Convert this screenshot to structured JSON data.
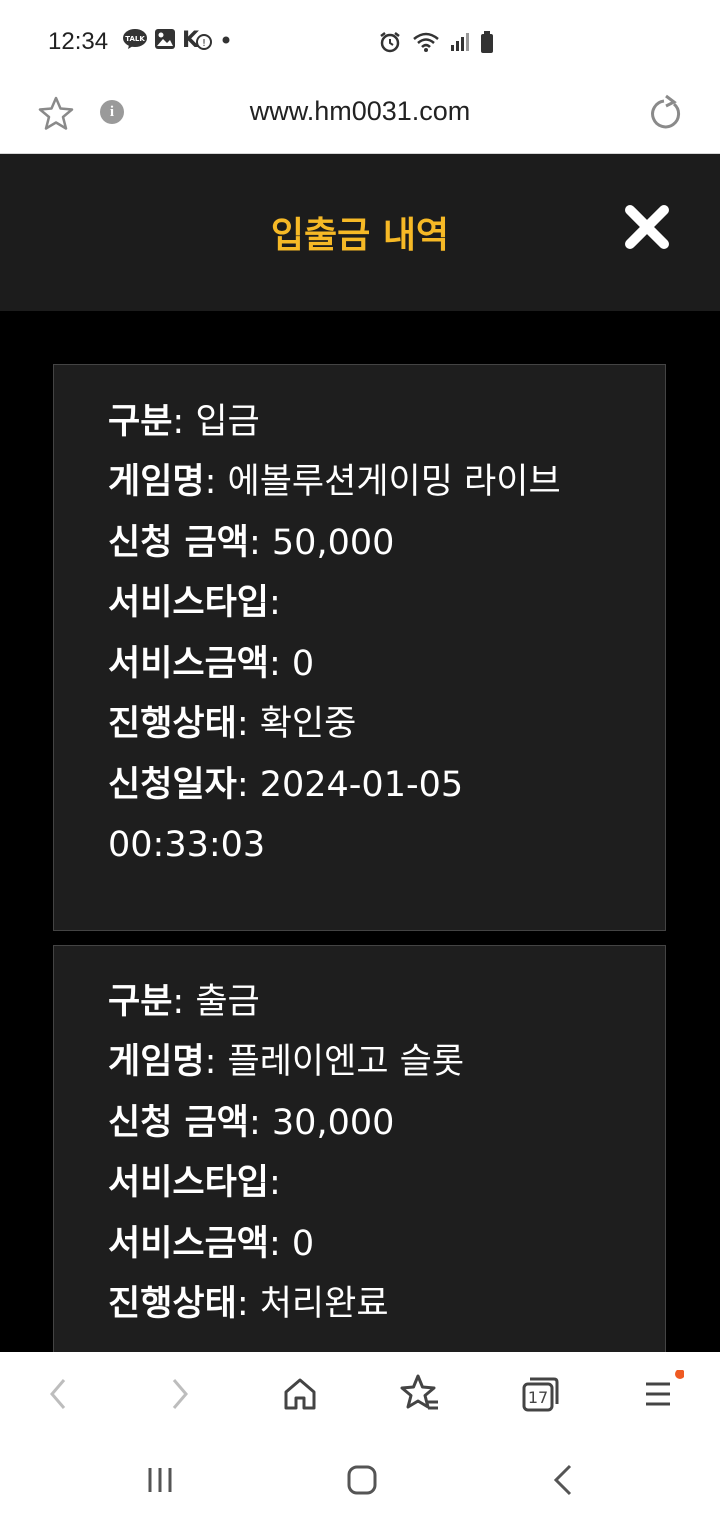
{
  "status_bar": {
    "time": "12:34",
    "icons": [
      "kakaotalk-icon",
      "gallery-icon",
      "notification-icon",
      "dot-icon",
      "alarm-icon",
      "wifi-icon",
      "signal-icon",
      "battery-icon"
    ]
  },
  "browser": {
    "url": "www.hm0031.com",
    "tab_count": "17"
  },
  "page": {
    "title": "입출금 내역",
    "accent_color": "#f6b926"
  },
  "transactions": [
    {
      "type_label": "구분",
      "type_value": ": 입금",
      "game_label": "게임명",
      "game_value": ": 에볼루션게이밍 라이브",
      "amount_label": "신청 금액",
      "amount_value": ": 50,000",
      "service_type_label": "서비스타입",
      "service_type_value": ":",
      "service_amount_label": "서비스금액",
      "service_amount_value": ": 0",
      "status_label": "진행상태",
      "status_value": ": 확인중",
      "date_label": "신청일자",
      "date_value": ": 2024-01-05",
      "time_value": "00:33:03"
    },
    {
      "type_label": "구분",
      "type_value": ": 출금",
      "game_label": "게임명",
      "game_value": ": 플레이엔고 슬롯",
      "amount_label": "신청 금액",
      "amount_value": ": 30,000",
      "service_type_label": "서비스타입",
      "service_type_value": ":",
      "service_amount_label": "서비스금액",
      "service_amount_value": ": 0",
      "status_label": "진행상태",
      "status_value": ": 처리완료"
    }
  ]
}
